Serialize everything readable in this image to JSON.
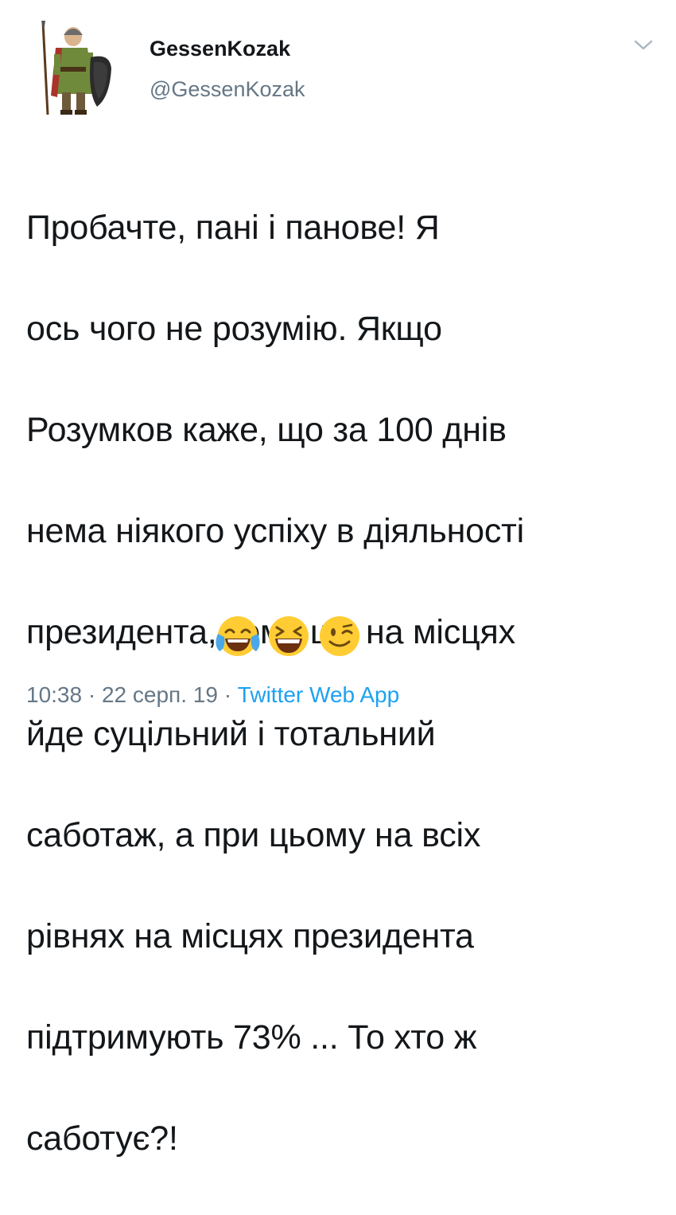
{
  "tweet": {
    "author": {
      "display_name": "GessenKozak",
      "handle": "@GessenKozak",
      "avatar_icon": "medieval-soldier-avatar"
    },
    "menu_icon": "chevron-down-icon",
    "text_lines": [
      "Пробачте, пані і панове! Я",
      "ось чого не розумію. Якщо",
      "Розумков каже, що за 100 днів",
      "нема ніякого успіху в діяльності",
      "президента, тому що на місцях",
      "йде суцільний і тотальний",
      "саботаж, а при цьому на всіх",
      "рівнях на місцях президента",
      "підтримують 73% ... То хто ж",
      "саботує?!"
    ],
    "emojis": [
      "face-with-tears-of-joy",
      "grinning-squinting-face",
      "winking-face"
    ],
    "time": "10:38",
    "separator": "·",
    "date": "22 серп. 19",
    "source": "Twitter Web App",
    "colors": {
      "text": "#14171a",
      "secondary": "#657786",
      "link": "#1da1f2"
    }
  }
}
